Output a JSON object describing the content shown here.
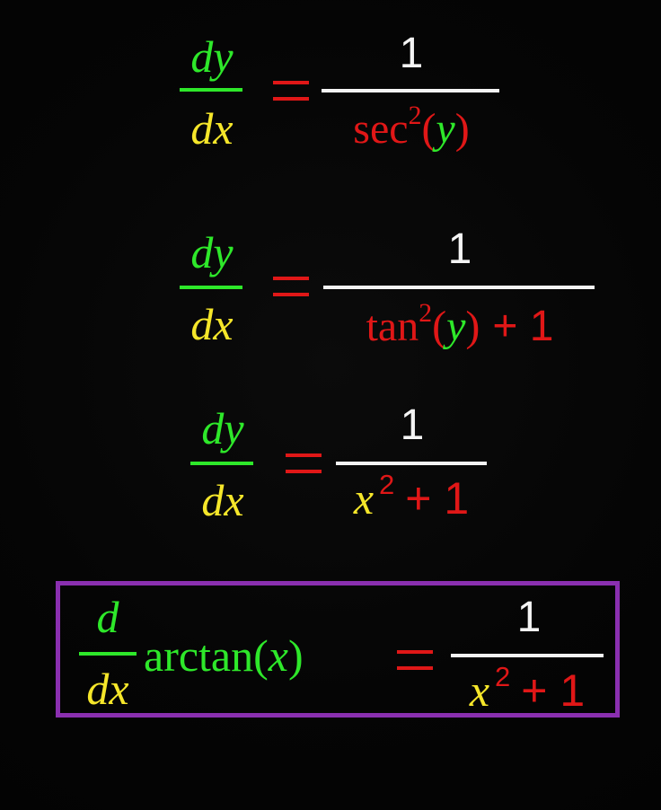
{
  "colors": {
    "dy_color": "#2ee82a",
    "dx_color": "#f5e62a",
    "denominator_color": "#e01717",
    "numerator_color": "#f4f4f4",
    "box_color": "#8a2fb0"
  },
  "equations": [
    {
      "lhs_num": "dy",
      "lhs_den": "dx",
      "rhs_num": "1",
      "rhs_den_func": "sec",
      "rhs_den_exp": "2",
      "rhs_den_open": "(",
      "rhs_den_var": "y",
      "rhs_den_close": ")"
    },
    {
      "lhs_num": "dy",
      "lhs_den": "dx",
      "rhs_num": "1",
      "rhs_den_func": "tan",
      "rhs_den_exp": "2",
      "rhs_den_open": "(",
      "rhs_den_var": "y",
      "rhs_den_close": ")",
      "rhs_den_tail": "+ 1"
    },
    {
      "lhs_num": "dy",
      "lhs_den": "dx",
      "rhs_num": "1",
      "rhs_den_var": "x",
      "rhs_den_exp": "2",
      "rhs_den_tail": "+ 1"
    },
    {
      "lhs_num": "d",
      "lhs_den": "dx",
      "lhs_func": "arctan(",
      "lhs_var": "x",
      "lhs_close": ")",
      "rhs_num": "1",
      "rhs_den_var": "x",
      "rhs_den_exp": "2",
      "rhs_den_tail": "+ 1"
    }
  ]
}
